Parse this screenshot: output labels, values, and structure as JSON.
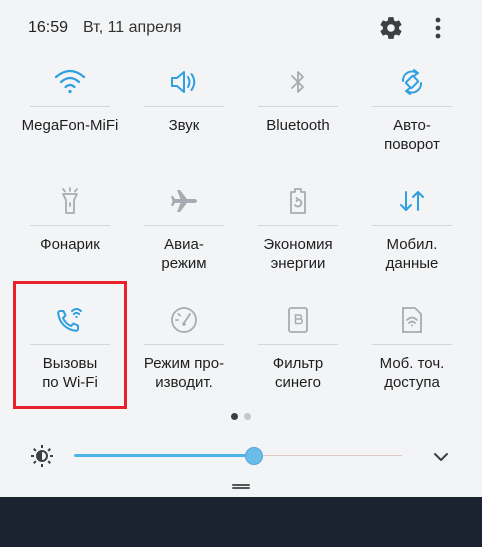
{
  "status": {
    "time": "16:59",
    "date": "Вт, 11 апреля"
  },
  "colors": {
    "accent": "#2f9fe0",
    "inactive_icon": "#a8abb1",
    "highlight": "#e8212b"
  },
  "tiles": [
    {
      "label": "MegaFon-MiFi",
      "icon": "wifi-icon",
      "active": true
    },
    {
      "label": "Звук",
      "icon": "sound-icon",
      "active": true
    },
    {
      "label": "Bluetooth",
      "icon": "bluetooth-icon",
      "active": false
    },
    {
      "label": "Авто-\nповорот",
      "icon": "auto-rotate-icon",
      "active": true
    },
    {
      "label": "Фонарик",
      "icon": "flashlight-icon",
      "active": false
    },
    {
      "label": "Авиа-\nрежим",
      "icon": "airplane-icon",
      "active": false
    },
    {
      "label": "Экономия\nэнергии",
      "icon": "power-saving-icon",
      "active": false
    },
    {
      "label": "Мобил.\nданные",
      "icon": "mobile-data-icon",
      "active": true
    },
    {
      "label": "Вызовы\nпо Wi-Fi",
      "icon": "wifi-calling-icon",
      "active": true
    },
    {
      "label": "Режим про-\nизводит.",
      "icon": "performance-mode-icon",
      "active": false
    },
    {
      "label": "Фильтр\nсинего",
      "icon": "blue-light-filter-icon",
      "active": false
    },
    {
      "label": "Моб. точ.\nдоступа",
      "icon": "mobile-hotspot-icon",
      "active": false
    }
  ],
  "pager": {
    "pages": 2,
    "current": 1
  },
  "brightness": {
    "level": 0.55
  }
}
